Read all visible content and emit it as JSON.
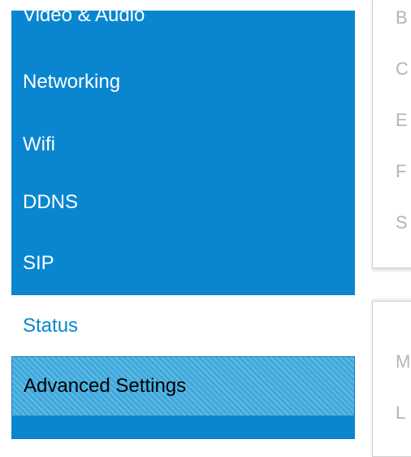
{
  "sidebar": {
    "items": [
      {
        "label": "Video & Audio",
        "state": "normal"
      },
      {
        "label": "Networking",
        "state": "normal"
      },
      {
        "label": "Wifi",
        "state": "normal"
      },
      {
        "label": "DDNS",
        "state": "normal"
      },
      {
        "label": "SIP",
        "state": "normal"
      },
      {
        "label": "Status",
        "state": "active"
      },
      {
        "label": "Advanced Settings",
        "state": "highlight"
      }
    ]
  },
  "right_panel": {
    "top_letters": [
      "B",
      "C",
      "E",
      "F",
      "S"
    ],
    "bottom_letters": [
      "M",
      "L"
    ]
  },
  "colors": {
    "sidebar_bg": "#0a86d0",
    "active_text": "#0a86d0",
    "hatch_bg": "#3fa9dc"
  }
}
